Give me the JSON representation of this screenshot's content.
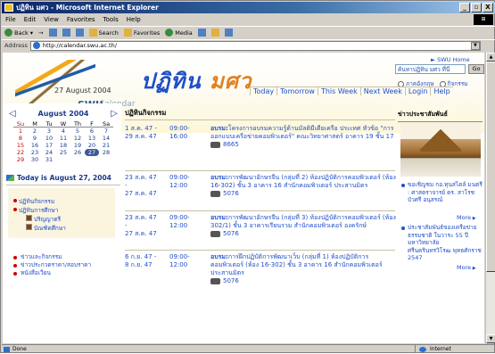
{
  "window": {
    "title": "ปฏิทิน มศว - Microsoft Internet Explorer",
    "min": "_",
    "max": "▫",
    "close": "X"
  },
  "menu": [
    "File",
    "Edit",
    "View",
    "Favorites",
    "Tools",
    "Help"
  ],
  "toolbar": {
    "back": "Back",
    "search": "Search",
    "favorites": "Favorites",
    "media": "Media"
  },
  "address": {
    "label": "Address",
    "url": "http://calendar.swu.ac.th/"
  },
  "status": {
    "left": "Done",
    "right": "Internet"
  },
  "header": {
    "logo_swu": "SWU",
    "logo_calendar": "Calendar",
    "title_main": "ปฏิทิน",
    "title_swu": "มศว",
    "swu_home": "► SWU Home",
    "search_value": "ค้นหาปฏิทิน มศว ที่นี่",
    "go": "Go",
    "radio1": "ภาคอังกฤษ",
    "radio2": "กิจกรรม",
    "date": "27 August 2004",
    "links": [
      "Today",
      "Tomorrow",
      "This Week",
      "Next Week",
      "Login",
      "Help"
    ]
  },
  "calendar": {
    "month": "August 2004",
    "days": [
      "Su",
      "M",
      "Tu",
      "W",
      "Th",
      "F",
      "Sa"
    ],
    "rows": [
      [
        "1",
        "2",
        "3",
        "4",
        "5",
        "6",
        "7"
      ],
      [
        "8",
        "9",
        "10",
        "11",
        "12",
        "13",
        "14"
      ],
      [
        "15",
        "16",
        "17",
        "18",
        "19",
        "20",
        "21"
      ],
      [
        "22",
        "23",
        "24",
        "25",
        "26",
        "27",
        "28"
      ],
      [
        "29",
        "30",
        "31",
        "",
        "",
        "",
        ""
      ]
    ],
    "today": "Today is August 27, 2004"
  },
  "leftmenu": {
    "item1": "ปฏิทินกิจกรรม",
    "item2": "ปฏิทินการศึกษา",
    "sub1": "ปริญญาตรี",
    "sub2": "บัณฑิตศึกษา",
    "news": [
      "ข่าวและกิจกรรม",
      "ข่าวประกวดราคา/สอบราคา",
      "หนังสือเวียน"
    ]
  },
  "main": {
    "heading": "ปฏิทินกิจกรรม",
    "events": [
      {
        "d1": "1 ส.ค. 47 -",
        "d2": "29 ส.ค. 47",
        "t1": "09:00-",
        "t2": "16:00",
        "title": "อบรม:",
        "text": "โครงการอบรมความรู้ด้านมัลติมีเดียเครือ ประเทศ หัวข้อ \"การออกแบบเครือข่ายคอมพิวเตอร์\" คณะวิทยาศาสตร์ อาคาร 19 ชั้น 17",
        "phone": "8665"
      },
      {
        "d1": "23 ส.ค. 47 -",
        "d2": "27 ส.ค. 47",
        "t1": "09:00-",
        "t2": "12:00",
        "title": "อบรม:",
        "text": "การพัฒนาอักษรจีน (กลุ่มที่ 2) ห้องปฏิบัติการคอมพิวเตอร์ (ห้อง 16-302) ชั้น 3 อาคาร 16 สำนักคอมพิวเตอร์ ประสานมิตร",
        "phone": "5076"
      },
      {
        "d1": "23 ส.ค. 47 -",
        "d2": "27 ส.ค. 47",
        "t1": "09:00-",
        "t2": "12:00",
        "title": "อบรม:",
        "text": "การพัฒนาอักษรจีน (กลุ่มที่ 3) ห้องปฏิบัติการคอมพิวเตอร์ (ห้อง 302/1) ชั้น 3 อาคารเรียนรวม สำนักคอมพิวเตอร์ องครักษ์",
        "phone": "5076"
      },
      {
        "d1": "6 ก.ย. 47 -",
        "d2": "8 ก.ย. 47",
        "t1": "09:00-",
        "t2": "12:00",
        "title": "อบรม:",
        "text": "การฝึกปฏิบัติการพัฒนาเว็บ (กลุ่มที่ 1) ห้องปฏิบัติการคอมพิวเตอร์ (ห้อง 16-302) ชั้น 3 อาคาร 16 สำนักคอมพิวเตอร์ ประสานมิตร",
        "phone": "5076"
      }
    ]
  },
  "right": {
    "heading": "ข่าวประชาสัมพันธ์",
    "news1": "ขอเชิญชม กอ.ทุนสไตล์ มนตรี : ศาสตราจารย์ ดร. สาโรช บัวศรี อนุสรณ์",
    "more1": "More",
    "news2": "ประชาสัมพันธ์ของเครือข่ายธรรมชาติ ในวาระ 55 ปี มหาวิทยาลัยศรีนครินทรวิโรฒ พุทธศักราช 2547",
    "more2": "More"
  }
}
